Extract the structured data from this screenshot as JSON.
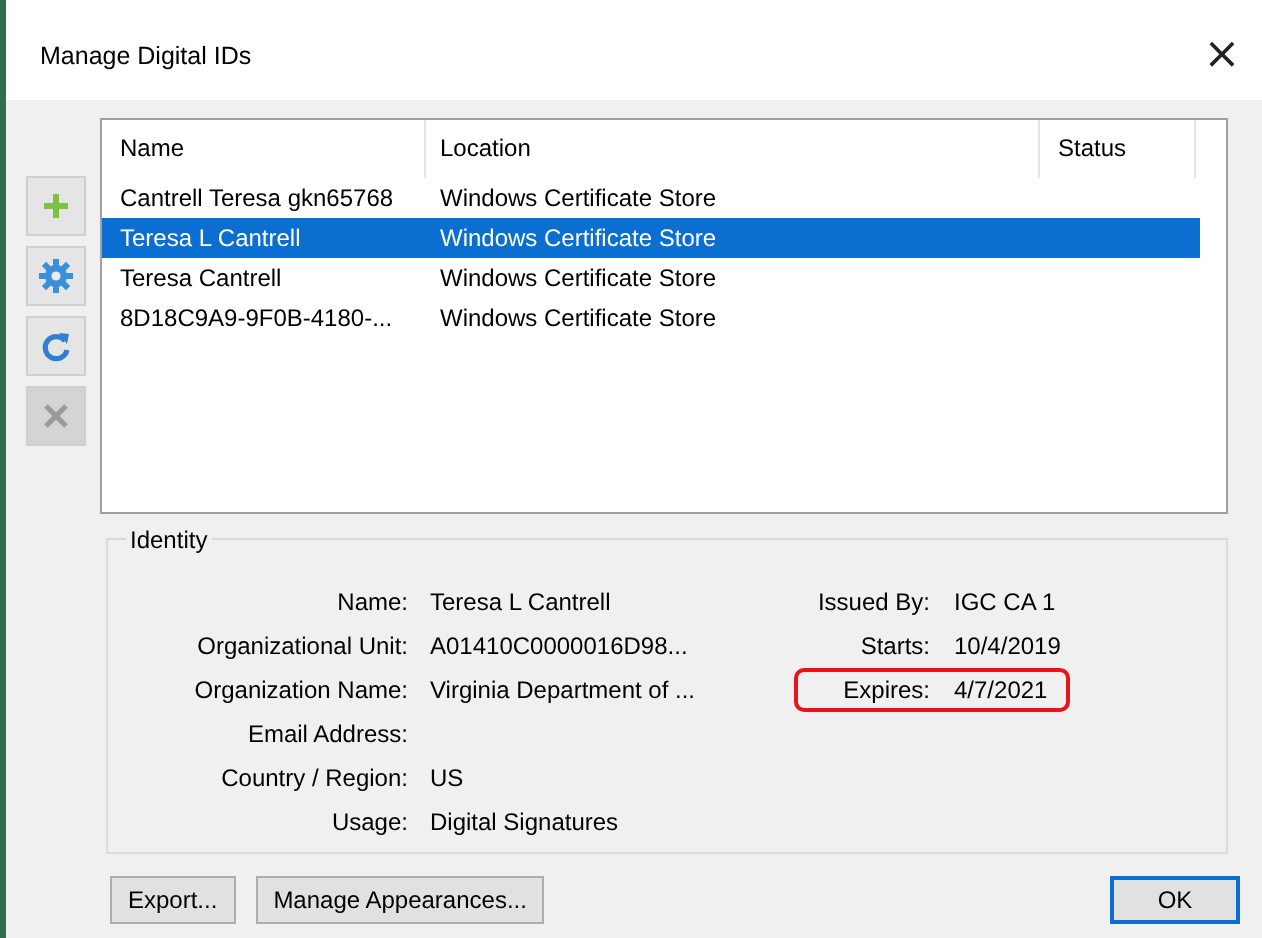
{
  "window": {
    "title": "Manage Digital IDs",
    "close": "×"
  },
  "toolbar": [
    {
      "disabled": false
    },
    {
      "disabled": false
    },
    {
      "disabled": false
    },
    {
      "disabled": true
    }
  ],
  "table": {
    "columns": [
      "Name",
      "Location",
      "Status"
    ],
    "rows": [
      {
        "name": "Cantrell Teresa gkn65768",
        "location": "Windows Certificate Store",
        "selected": false
      },
      {
        "name": "Teresa L Cantrell",
        "location": "Windows Certificate Store",
        "selected": true
      },
      {
        "name": "Teresa Cantrell",
        "location": "Windows Certificate Store",
        "selected": false
      },
      {
        "name": "8D18C9A9-9F0B-4180-...",
        "location": "Windows Certificate Store",
        "selected": false
      }
    ]
  },
  "identity": {
    "title": "Identity",
    "left": [
      {
        "label": "Name:",
        "value": "Teresa L Cantrell"
      },
      {
        "label": "Organizational Unit:",
        "value": "A01410C0000016D98..."
      },
      {
        "label": "Organization Name:",
        "value": "Virginia Department of ..."
      },
      {
        "label": "Email Address:"
      },
      {
        "label": "Country / Region:",
        "value": "US"
      },
      {
        "label": "Usage:",
        "value": "Digital Signatures"
      }
    ],
    "right": [
      {
        "label": "Issued By:",
        "value": "IGC CA 1",
        "highlighted": false
      },
      {
        "label": "Starts:",
        "value": "10/4/2019",
        "highlighted": false
      },
      {
        "label": "Expires:",
        "value": "4/7/2021",
        "highlighted": true
      }
    ]
  },
  "buttons": [
    {
      "label": "Export..."
    },
    {
      "label": "Manage Appearances..."
    }
  ],
  "ok_button": "OK"
}
